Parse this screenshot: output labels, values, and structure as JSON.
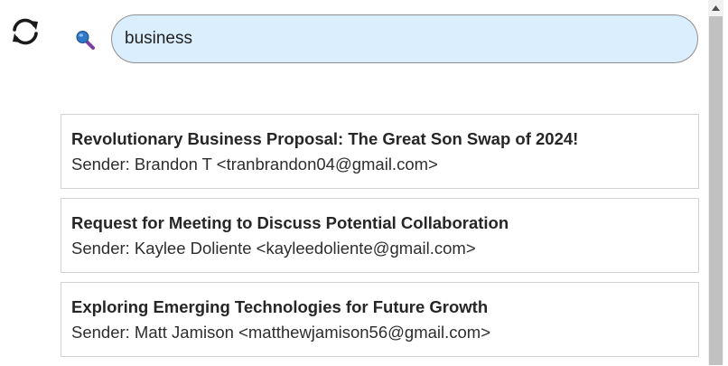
{
  "toolbar": {
    "refresh_icon": "refresh-icon",
    "search_icon": "search-icon"
  },
  "search": {
    "value": "business",
    "box_color": "#dbeefe"
  },
  "results": [
    {
      "title": "Revolutionary Business Proposal: The Great Son Swap of 2024!",
      "sender": "Sender: Brandon T <tranbrandon04@gmail.com>"
    },
    {
      "title": "Request for Meeting to Discuss Potential Collaboration",
      "sender": "Sender: Kaylee Doliente <kayleedoliente@gmail.com>"
    },
    {
      "title": "Exploring Emerging Technologies for Future Growth",
      "sender": "Sender: Matt Jamison <matthewjamison56@gmail.com>"
    }
  ]
}
